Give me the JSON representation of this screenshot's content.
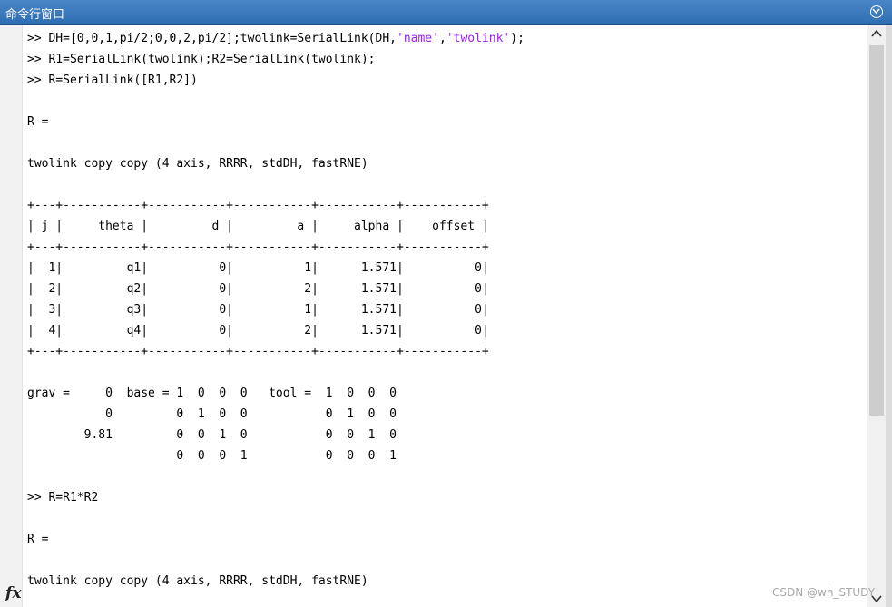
{
  "window": {
    "title": "命令行窗口",
    "menu_icon": "chevron-down-circle-icon"
  },
  "console_lines": [
    ">> DH=[0,0,1,pi/2;0,0,2,pi/2];twolink=SerialLink(DH,'name','twolink');",
    ">> R1=SerialLink(twolink);R2=SerialLink(twolink);",
    ">> R=SerialLink([R1,R2])",
    "",
    "R =",
    "",
    "twolink copy copy (4 axis, RRRR, stdDH, fastRNE)",
    "",
    "+---+-----------+-----------+-----------+-----------+-----------+",
    "| j |     theta |         d |         a |     alpha |    offset |",
    "+---+-----------+-----------+-----------+-----------+-----------+",
    "|  1|         q1|          0|          1|      1.571|          0|",
    "|  2|         q2|          0|          2|      1.571|          0|",
    "|  3|         q3|          0|          1|      1.571|          0|",
    "|  4|         q4|          0|          2|      1.571|          0|",
    "+---+-----------+-----------+-----------+-----------+-----------+",
    "",
    "grav =     0  base = 1  0  0  0   tool =  1  0  0  0",
    "           0         0  1  0  0           0  1  0  0",
    "        9.81         0  0  1  0           0  0  1  0",
    "                     0  0  0  1           0  0  0  1",
    "",
    ">> R=R1*R2",
    "",
    "R =",
    "",
    "twolink copy copy (4 axis, RRRR, stdDH, fastRNE)"
  ],
  "strings_highlight": [
    "'name'",
    "'twolink'"
  ],
  "colors": {
    "titlebar": "#2f6db2",
    "string_literal": "#a020f0",
    "scroll_thumb": "#cdcdcd"
  },
  "prompt_icon": "fx",
  "watermark": "CSDN @wh_STUDY"
}
